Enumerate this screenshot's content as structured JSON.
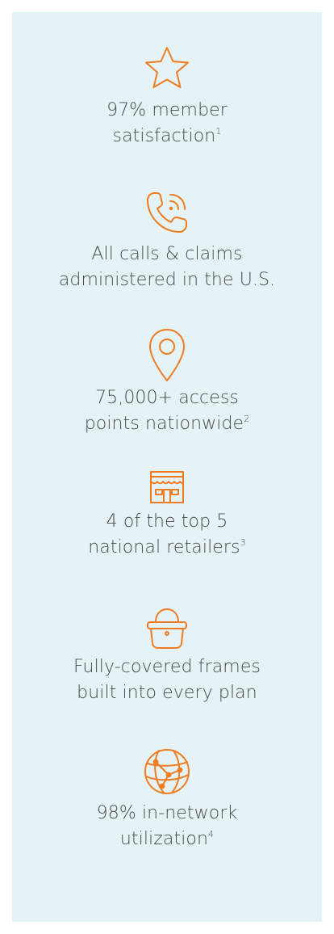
{
  "colors": {
    "panel_bg": "#e6f3f6",
    "accent": "#f07c22",
    "text": "#4a4a4a"
  },
  "features": [
    {
      "icon": "star-icon",
      "line1": "97% member",
      "line2": "satisfaction",
      "sup": "1"
    },
    {
      "icon": "phone-icon",
      "line1": "All calls & claims",
      "line2": "administered in the U.S.",
      "sup": ""
    },
    {
      "icon": "location-pin-icon",
      "line1": "75,000+ access",
      "line2": "points nationwide",
      "sup": "2"
    },
    {
      "icon": "storefront-icon",
      "line1": "4 of the top 5",
      "line2": "national retailers",
      "sup": "3"
    },
    {
      "icon": "bag-icon",
      "line1": "Fully-covered frames",
      "line2": "built into every plan",
      "sup": ""
    },
    {
      "icon": "globe-network-icon",
      "line1": "98% in-network",
      "line2": "utilization",
      "sup": "4"
    }
  ]
}
